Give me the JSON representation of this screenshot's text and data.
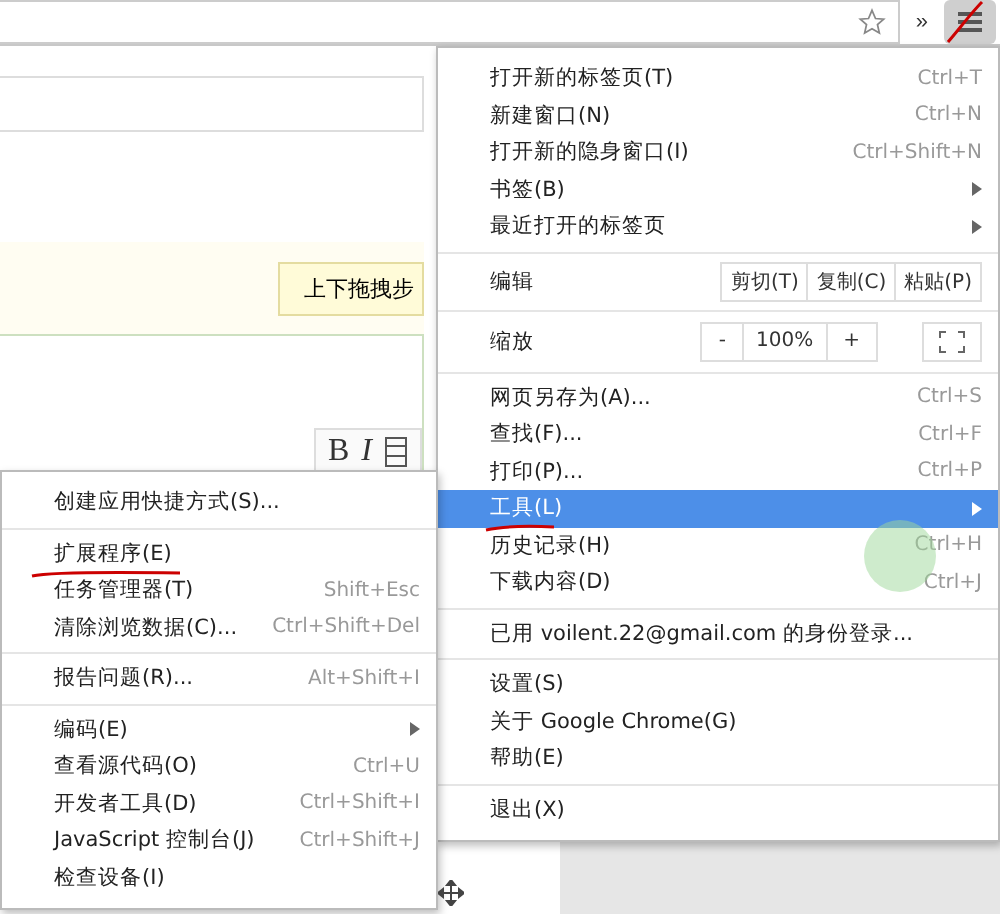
{
  "toolbar": {
    "overflow": "»"
  },
  "page": {
    "tooltip": "上下拖拽步",
    "editor_buttons": [
      "B",
      "I"
    ]
  },
  "main_menu": {
    "sections": [
      {
        "items": [
          {
            "kind": "item",
            "label": "打开新的标签页(T)",
            "shortcut": "Ctrl+T",
            "has_submenu": false,
            "selected": false
          },
          {
            "kind": "item",
            "label": "新建窗口(N)",
            "shortcut": "Ctrl+N",
            "has_submenu": false,
            "selected": false
          },
          {
            "kind": "item",
            "label": "打开新的隐身窗口(I)",
            "shortcut": "Ctrl+Shift+N",
            "has_submenu": false,
            "selected": false
          },
          {
            "kind": "item",
            "label": "书签(B)",
            "has_submenu": true,
            "selected": false
          },
          {
            "kind": "item",
            "label": "最近打开的标签页",
            "has_submenu": true,
            "selected": false
          }
        ]
      },
      {
        "items": [
          {
            "kind": "edit",
            "label": "编辑",
            "buttons": [
              "剪切(T)",
              "复制(C)",
              "粘贴(P)"
            ]
          }
        ]
      },
      {
        "items": [
          {
            "kind": "zoom",
            "label": "缩放",
            "minus": "-",
            "value": "100%",
            "plus": "+"
          }
        ]
      },
      {
        "items": [
          {
            "kind": "item",
            "label": "网页另存为(A)...",
            "shortcut": "Ctrl+S",
            "has_submenu": false,
            "selected": false
          },
          {
            "kind": "item",
            "label": "查找(F)...",
            "shortcut": "Ctrl+F",
            "has_submenu": false,
            "selected": false
          },
          {
            "kind": "item",
            "label": "打印(P)...",
            "shortcut": "Ctrl+P",
            "has_submenu": false,
            "selected": false
          },
          {
            "kind": "item",
            "label": "工具(L)",
            "has_submenu": true,
            "selected": true
          },
          {
            "kind": "item",
            "label": "历史记录(H)",
            "shortcut": "Ctrl+H",
            "has_submenu": false,
            "selected": false
          },
          {
            "kind": "item",
            "label": "下载内容(D)",
            "shortcut": "Ctrl+J",
            "has_submenu": false,
            "selected": false
          }
        ]
      },
      {
        "items": [
          {
            "kind": "item",
            "label": "已用 voilent.22@gmail.com 的身份登录...",
            "has_submenu": false,
            "selected": false
          }
        ]
      },
      {
        "items": [
          {
            "kind": "item",
            "label": "设置(S)",
            "has_submenu": false,
            "selected": false
          },
          {
            "kind": "item",
            "label": "关于 Google Chrome(G)",
            "has_submenu": false,
            "selected": false
          },
          {
            "kind": "item",
            "label": "帮助(E)",
            "has_submenu": false,
            "selected": false
          }
        ]
      },
      {
        "items": [
          {
            "kind": "item",
            "label": "退出(X)",
            "has_submenu": false,
            "selected": false
          }
        ]
      }
    ]
  },
  "tools_submenu": {
    "sections": [
      {
        "items": [
          {
            "label": "创建应用快捷方式(S)...",
            "has_submenu": false,
            "selected": false
          }
        ]
      },
      {
        "items": [
          {
            "label": "扩展程序(E)",
            "has_submenu": false,
            "selected": false
          },
          {
            "label": "任务管理器(T)",
            "shortcut": "Shift+Esc",
            "has_submenu": false,
            "selected": false
          },
          {
            "label": "清除浏览数据(C)...",
            "shortcut": "Ctrl+Shift+Del",
            "has_submenu": false,
            "selected": false
          }
        ]
      },
      {
        "items": [
          {
            "label": "报告问题(R)...",
            "shortcut": "Alt+Shift+I",
            "has_submenu": false,
            "selected": false
          }
        ]
      },
      {
        "items": [
          {
            "label": "编码(E)",
            "has_submenu": true,
            "selected": false
          },
          {
            "label": "查看源代码(O)",
            "shortcut": "Ctrl+U",
            "has_submenu": false,
            "selected": false
          },
          {
            "label": "开发者工具(D)",
            "shortcut": "Ctrl+Shift+I",
            "has_submenu": false,
            "selected": false
          },
          {
            "label": "JavaScript 控制台(J)",
            "shortcut": "Ctrl+Shift+J",
            "has_submenu": false,
            "selected": false
          },
          {
            "label": "检查设备(I)",
            "has_submenu": false,
            "selected": false
          }
        ]
      }
    ]
  }
}
